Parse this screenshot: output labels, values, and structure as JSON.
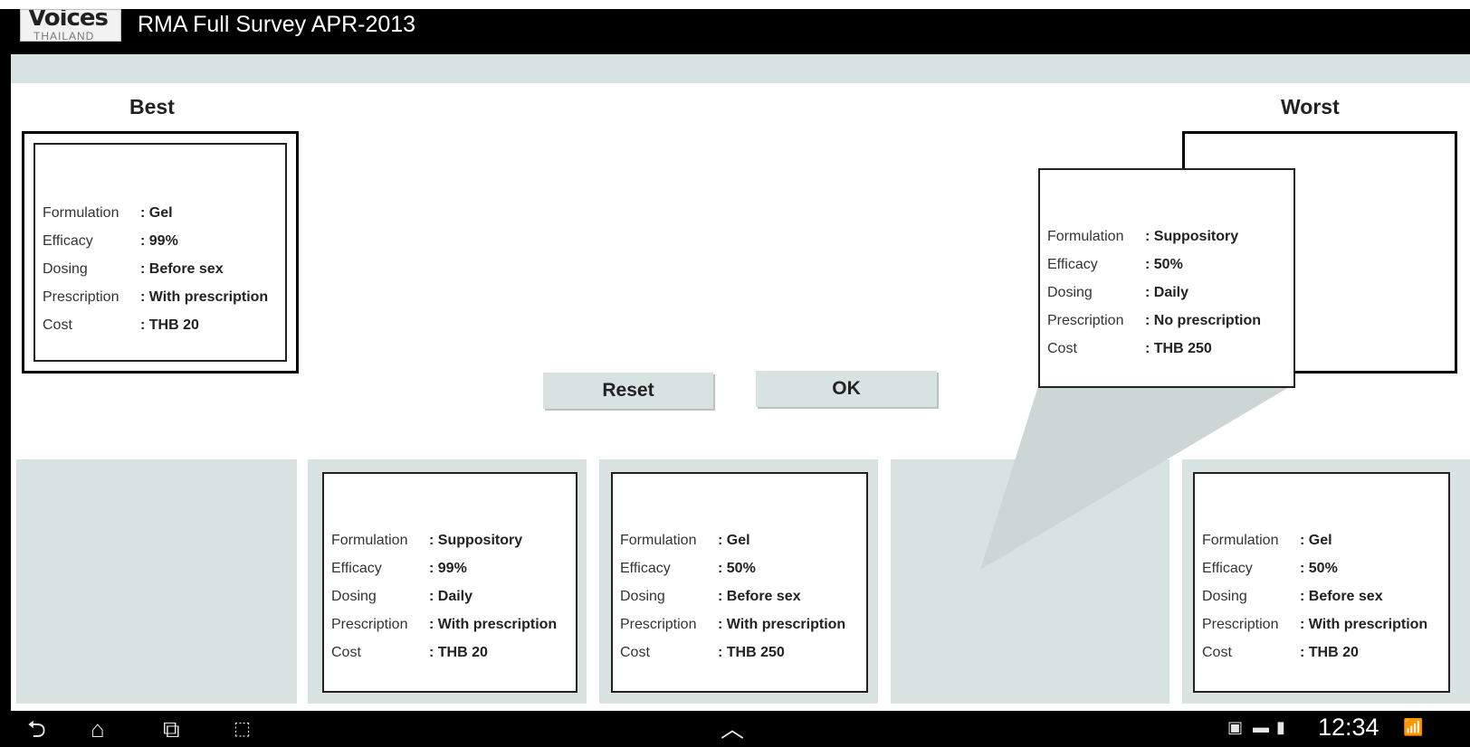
{
  "app": {
    "logo_main": "Voices",
    "logo_sub": "THAILAND",
    "title": "RMA Full Survey APR-2013"
  },
  "labels": {
    "best": "Best",
    "worst": "Worst"
  },
  "field_labels": {
    "formulation": "Formulation",
    "efficacy": "Efficacy",
    "dosing": "Dosing",
    "prescription": "Prescription",
    "cost": "Cost"
  },
  "cards": {
    "best": {
      "formulation": ": Gel",
      "efficacy": ": 99%",
      "dosing": ": Before sex",
      "prescription": ": With prescription",
      "cost": ": THB 20"
    },
    "dragging": {
      "formulation": ": Suppository",
      "efficacy": ": 50%",
      "dosing": ": Daily",
      "prescription": ": No prescription",
      "cost": ": THB 250"
    },
    "tile2": {
      "formulation": ": Suppository",
      "efficacy": ": 99%",
      "dosing": ": Daily",
      "prescription": ": With prescription",
      "cost": ": THB 20"
    },
    "tile3": {
      "formulation": ": Gel",
      "efficacy": ": 50%",
      "dosing": ": Before sex",
      "prescription": ": With prescription",
      "cost": ": THB 250"
    },
    "tile5": {
      "formulation": ": Gel",
      "efficacy": ": 50%",
      "dosing": ": Before sex",
      "prescription": ": With prescription",
      "cost": ": THB 20"
    }
  },
  "buttons": {
    "reset": "Reset",
    "ok": "OK"
  },
  "status": {
    "time": "12:34"
  },
  "icons": {
    "back": "back-icon",
    "home": "home-icon",
    "recent": "recent-apps-icon",
    "screenshot": "screenshot-icon",
    "up": "chevron-up-icon"
  },
  "colors": {
    "tile": "#d8e2e0",
    "titlebar": "#000000"
  }
}
